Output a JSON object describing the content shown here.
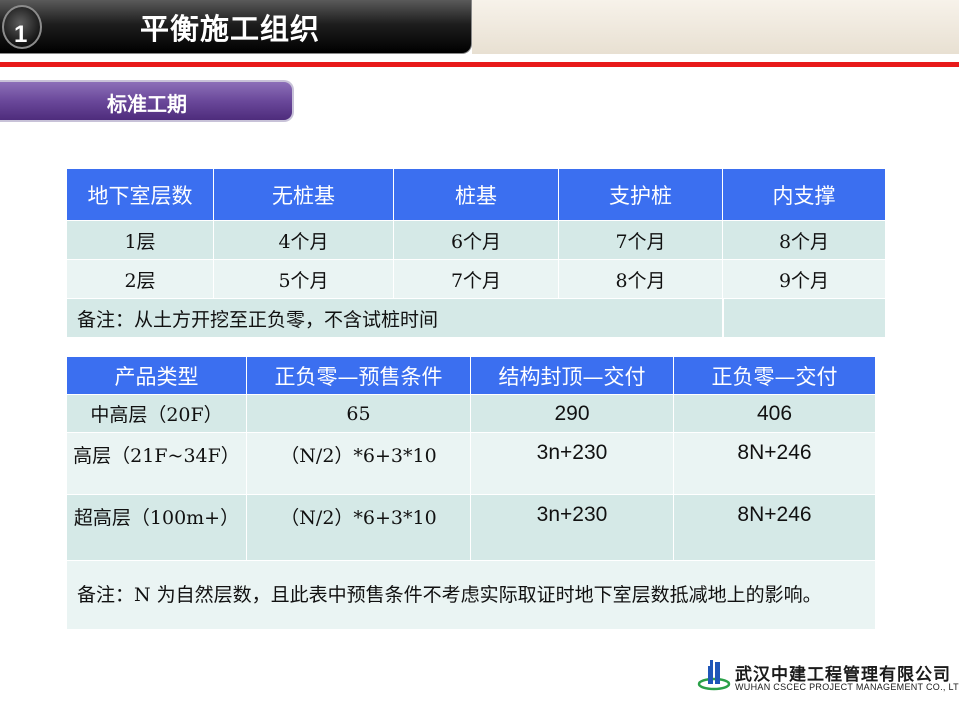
{
  "header": {
    "slide_number": "1",
    "title": "平衡施工组织"
  },
  "section": {
    "label": "标准工期"
  },
  "table1": {
    "headers": [
      "地下室层数",
      "无桩基",
      "桩基",
      "支护桩",
      "内支撑"
    ],
    "rows": [
      [
        "1层",
        "4个月",
        "6个月",
        "7个月",
        "8个月"
      ],
      [
        "2层",
        "5个月",
        "7个月",
        "8个月",
        "9个月"
      ]
    ],
    "note": "备注：从土方开挖至正负零，不含试桩时间"
  },
  "table2": {
    "headers": [
      "产品类型",
      "正负零—预售条件",
      "结构封顶—交付",
      "正负零—交付"
    ],
    "rows": [
      [
        "中高层（20F）",
        "65",
        "290",
        "406"
      ],
      [
        "高层（21F~34F）",
        "（N/2）*6+3*10",
        "3n+230",
        "8N+246"
      ],
      [
        "超高层（100m+）",
        "（N/2）*6+3*10",
        "3n+230",
        "8N+246"
      ]
    ],
    "note": "备注：N 为自然层数，且此表中预售条件不考虑实际取证时地下室层数抵减地上的影响。"
  },
  "logo": {
    "name_cn": "武汉中建工程管理有限公司",
    "name_en": "WUHAN CSCEC PROJECT MANAGEMENT CO., LTD"
  },
  "colors": {
    "header_blue": "#3b6ff0",
    "accent_red": "#e81a1a",
    "tab_purple": "#6a489a"
  }
}
